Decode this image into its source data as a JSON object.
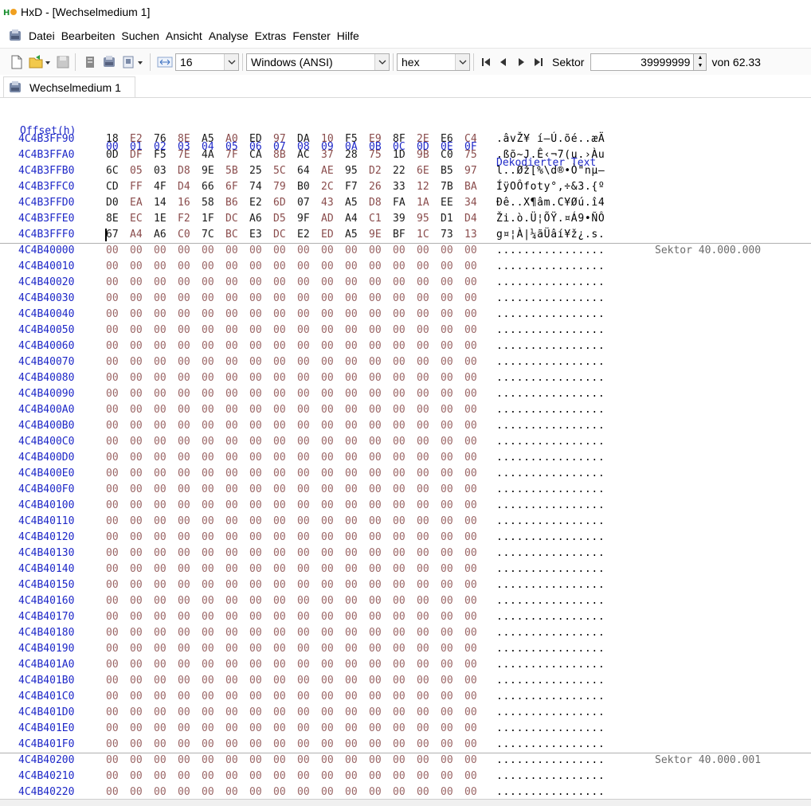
{
  "window": {
    "title": "HxD - [Wechselmedium 1]"
  },
  "menu": {
    "items": [
      "Datei",
      "Bearbeiten",
      "Suchen",
      "Ansicht",
      "Analyse",
      "Extras",
      "Fenster",
      "Hilfe"
    ]
  },
  "toolbar": {
    "bytes_per_row": "16",
    "charset": "Windows (ANSI)",
    "offset_base": "hex",
    "sector_label": "Sektor",
    "sector_value": "39999999",
    "sector_total": "von 62.33"
  },
  "tab": {
    "label": "Wechselmedium 1"
  },
  "hex_view": {
    "header": {
      "offset": "Offset(h)",
      "columns": [
        "00",
        "01",
        "02",
        "03",
        "04",
        "05",
        "06",
        "07",
        "08",
        "09",
        "0A",
        "0B",
        "0C",
        "0D",
        "0E",
        "0F"
      ],
      "decoded": "Dekodierter Text"
    },
    "rows": [
      {
        "offset": "4C4B3FF90",
        "bytes": [
          "18",
          "E2",
          "76",
          "8E",
          "A5",
          "A0",
          "ED",
          "97",
          "DA",
          "10",
          "F5",
          "E9",
          "8F",
          "2E",
          "E6",
          "C4"
        ],
        "text": ".âvŽ¥ í—Ú.õé..æÄ"
      },
      {
        "offset": "4C4B3FFA0",
        "bytes": [
          "0D",
          "DF",
          "F5",
          "7E",
          "4A",
          "7F",
          "CA",
          "8B",
          "AC",
          "37",
          "28",
          "75",
          "1D",
          "9B",
          "C0",
          "75"
        ],
        "text": ".ßõ~J.Ê‹¬7(u.›Àu"
      },
      {
        "offset": "4C4B3FFB0",
        "bytes": [
          "6C",
          "05",
          "03",
          "D8",
          "9E",
          "5B",
          "25",
          "5C",
          "64",
          "AE",
          "95",
          "D2",
          "22",
          "6E",
          "B5",
          "97"
        ],
        "text": "l..Øž[%\\d®•Ò\"nµ—"
      },
      {
        "offset": "4C4B3FFC0",
        "bytes": [
          "CD",
          "FF",
          "4F",
          "D4",
          "66",
          "6F",
          "74",
          "79",
          "B0",
          "2C",
          "F7",
          "26",
          "33",
          "12",
          "7B",
          "BA"
        ],
        "text": "ÍÿOÔfoty°,÷&3.{º"
      },
      {
        "offset": "4C4B3FFD0",
        "bytes": [
          "D0",
          "EA",
          "14",
          "16",
          "58",
          "B6",
          "E2",
          "6D",
          "07",
          "43",
          "A5",
          "D8",
          "FA",
          "1A",
          "EE",
          "34"
        ],
        "text": "Ðê..X¶âm.C¥Øú.î4"
      },
      {
        "offset": "4C4B3FFE0",
        "bytes": [
          "8E",
          "EC",
          "1E",
          "F2",
          "1F",
          "DC",
          "A6",
          "D5",
          "9F",
          "AD",
          "A4",
          "C1",
          "39",
          "95",
          "D1",
          "D4"
        ],
        "text": "Ži.ò.Ü¦ÕŸ.¤Á9•ÑÔ"
      },
      {
        "offset": "4C4B3FFF0",
        "bytes": [
          "67",
          "A4",
          "A6",
          "C0",
          "7C",
          "BC",
          "E3",
          "DC",
          "E2",
          "ED",
          "A5",
          "9E",
          "BF",
          "1C",
          "73",
          "13"
        ],
        "text": "g¤¦À|¼ãÜâí¥ž¿.s."
      },
      {
        "offset": "4C4B40000",
        "zero": true,
        "sector": "Sektor 40.000.000"
      },
      {
        "offset": "4C4B40010",
        "zero": true
      },
      {
        "offset": "4C4B40020",
        "zero": true
      },
      {
        "offset": "4C4B40030",
        "zero": true
      },
      {
        "offset": "4C4B40040",
        "zero": true
      },
      {
        "offset": "4C4B40050",
        "zero": true
      },
      {
        "offset": "4C4B40060",
        "zero": true
      },
      {
        "offset": "4C4B40070",
        "zero": true
      },
      {
        "offset": "4C4B40080",
        "zero": true
      },
      {
        "offset": "4C4B40090",
        "zero": true
      },
      {
        "offset": "4C4B400A0",
        "zero": true
      },
      {
        "offset": "4C4B400B0",
        "zero": true
      },
      {
        "offset": "4C4B400C0",
        "zero": true
      },
      {
        "offset": "4C4B400D0",
        "zero": true
      },
      {
        "offset": "4C4B400E0",
        "zero": true
      },
      {
        "offset": "4C4B400F0",
        "zero": true
      },
      {
        "offset": "4C4B40100",
        "zero": true
      },
      {
        "offset": "4C4B40110",
        "zero": true
      },
      {
        "offset": "4C4B40120",
        "zero": true
      },
      {
        "offset": "4C4B40130",
        "zero": true
      },
      {
        "offset": "4C4B40140",
        "zero": true
      },
      {
        "offset": "4C4B40150",
        "zero": true
      },
      {
        "offset": "4C4B40160",
        "zero": true
      },
      {
        "offset": "4C4B40170",
        "zero": true
      },
      {
        "offset": "4C4B40180",
        "zero": true
      },
      {
        "offset": "4C4B40190",
        "zero": true
      },
      {
        "offset": "4C4B401A0",
        "zero": true
      },
      {
        "offset": "4C4B401B0",
        "zero": true
      },
      {
        "offset": "4C4B401C0",
        "zero": true
      },
      {
        "offset": "4C4B401D0",
        "zero": true
      },
      {
        "offset": "4C4B401E0",
        "zero": true
      },
      {
        "offset": "4C4B401F0",
        "zero": true
      },
      {
        "offset": "4C4B40200",
        "zero": true,
        "sector": "Sektor 40.000.001"
      },
      {
        "offset": "4C4B40210",
        "zero": true
      },
      {
        "offset": "4C4B40220",
        "zero": true
      }
    ],
    "zero_byte": "00",
    "zero_text": "................"
  },
  "colors": {
    "offset_blue": "#1e28c8",
    "byte_dark": "#1a1a1a",
    "byte_light": "#8a4c4c",
    "sector_gray": "#6b6b6b"
  },
  "icons": [
    "hxd-app-icon",
    "disk-icon",
    "new-file-icon",
    "open-folder-icon",
    "save-icon",
    "save-all-icon",
    "disk-image-icon",
    "ram-icon",
    "bytes-per-row-icon",
    "first-icon",
    "prev-icon",
    "next-icon",
    "last-icon"
  ]
}
